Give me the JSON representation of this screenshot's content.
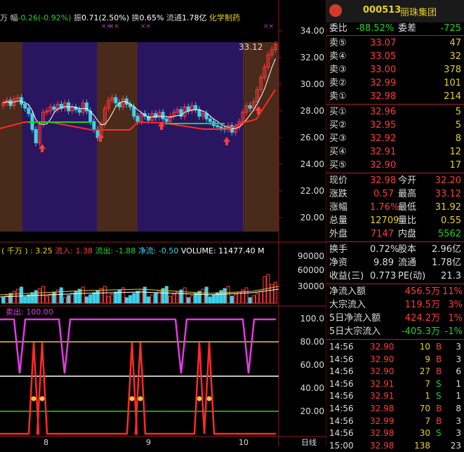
{
  "topbar": {
    "prefix": "万",
    "amp_label": "幅",
    "amp_value": "-0.26(-0.92%)",
    "zhen_label": "振",
    "zhen_value": "0.71(2.50%)",
    "huan_label": "换",
    "huan_value": "0.65%",
    "liutong_label": "流通",
    "liutong_value": "1.78亿",
    "industry": "化学制药"
  },
  "price_axis": [
    "34.00",
    "32.00",
    "30.00",
    "28.00",
    "26.00",
    "24.00",
    "22.00",
    "20.00"
  ],
  "price_marker": "33.12",
  "volume_axis": [
    "90000",
    "60000",
    "30000"
  ],
  "indicator_axis": [
    "100.0",
    "80.00",
    "60.00",
    "40.00",
    "20.00"
  ],
  "date_labels": [
    "8",
    "9",
    "10"
  ],
  "period_label": "日线",
  "fund_flow": {
    "open": "( 千万 ) : 3.25",
    "in_label": "流入:",
    "in_value": "1.38",
    "out_label": "流出:",
    "out_value": "-1.88",
    "net_label": "净流:",
    "net_value": "-0.50",
    "volume_label": "VOLUME:",
    "volume_value": "11477.40",
    "trail": "M"
  },
  "sell_label": "卖出: 100.00",
  "quote": {
    "code": "000513",
    "name": "丽珠集团",
    "weibi_label": "委比",
    "weibi_value": "-88.52%",
    "weicha_label": "委差",
    "weicha_value": "-725",
    "sells": [
      {
        "label": "卖⑤",
        "price": "33.07",
        "vol": "47"
      },
      {
        "label": "卖④",
        "price": "33.05",
        "vol": "32"
      },
      {
        "label": "卖③",
        "price": "33.00",
        "vol": "378"
      },
      {
        "label": "卖②",
        "price": "32.99",
        "vol": "101"
      },
      {
        "label": "卖①",
        "price": "32.98",
        "vol": "214"
      }
    ],
    "buys": [
      {
        "label": "买①",
        "price": "32.96",
        "vol": "5"
      },
      {
        "label": "买②",
        "price": "32.95",
        "vol": "5"
      },
      {
        "label": "买③",
        "price": "32.92",
        "vol": "8"
      },
      {
        "label": "买④",
        "price": "32.91",
        "vol": "12"
      },
      {
        "label": "买⑤",
        "price": "32.90",
        "vol": "17"
      }
    ],
    "stats": [
      {
        "l1": "现价",
        "v1": "32.98",
        "c1": "#ff3b3b",
        "l2": "今开",
        "v2": "32.20",
        "c2": "#ff3b3b"
      },
      {
        "l1": "涨跌",
        "v1": "0.57",
        "c1": "#ff3b3b",
        "l2": "最高",
        "v2": "33.12",
        "c2": "#ff3b3b"
      },
      {
        "l1": "涨幅",
        "v1": "1.76%",
        "c1": "#ff3b3b",
        "l2": "最低",
        "v2": "31.92",
        "c2": "#e6d21c"
      },
      {
        "l1": "总量",
        "v1": "12709",
        "c1": "#e6d21c",
        "l2": "量比",
        "v2": "0.55",
        "c2": "#e6d21c"
      },
      {
        "l1": "外盘",
        "v1": "7147",
        "c1": "#ff3b3b",
        "l2": "内盘",
        "v2": "5562",
        "c2": "#21d321"
      }
    ],
    "stats2": [
      {
        "l1": "换手",
        "v1": "0.72%",
        "c1": "#ddd",
        "l2": "股本",
        "v2": "2.96亿",
        "c2": "#ddd"
      },
      {
        "l1": "净资",
        "v1": "9.89",
        "c1": "#ddd",
        "l2": "流通",
        "v2": "1.78亿",
        "c2": "#ddd"
      },
      {
        "l1": "收益(三)",
        "v1": "0.773",
        "c1": "#ddd",
        "l2": "PE(动)",
        "v2": "21.3",
        "c2": "#ddd"
      }
    ],
    "flows": [
      {
        "label": "净流入额",
        "value": "456.5万",
        "pct": "11%",
        "color": "#ff3b3b"
      },
      {
        "label": "大宗流入",
        "value": "119.5万",
        "pct": "3%",
        "color": "#ff3b3b"
      },
      {
        "label": "5日净流入额",
        "value": "424.2万",
        "pct": "1%",
        "color": "#ff3b3b"
      },
      {
        "label": "5日大宗流入",
        "value": "-405.3万",
        "pct": "-1%",
        "color": "#21d321"
      }
    ],
    "ticks": [
      {
        "time": "14:56",
        "price": "32.90",
        "vol": "10",
        "bs": "B",
        "n": "3",
        "pc": "#ff3b3b",
        "bc": "#ff3b3b"
      },
      {
        "time": "14:56",
        "price": "32.90",
        "vol": "9",
        "bs": "B",
        "n": "3",
        "pc": "#ff3b3b",
        "bc": "#ff3b3b"
      },
      {
        "time": "14:56",
        "price": "32.90",
        "vol": "27",
        "bs": "B",
        "n": "6",
        "pc": "#ff3b3b",
        "bc": "#ff3b3b"
      },
      {
        "time": "14:56",
        "price": "32.91",
        "vol": "7",
        "bs": "S",
        "n": "1",
        "pc": "#ff3b3b",
        "bc": "#21d321"
      },
      {
        "time": "14:56",
        "price": "32.91",
        "vol": "1",
        "bs": "S",
        "n": "1",
        "pc": "#ff3b3b",
        "bc": "#21d321"
      },
      {
        "time": "14:56",
        "price": "32.98",
        "vol": "70",
        "bs": "B",
        "n": "8",
        "pc": "#ff3b3b",
        "bc": "#ff3b3b"
      },
      {
        "time": "14:56",
        "price": "32.99",
        "vol": "7",
        "bs": "B",
        "n": "3",
        "pc": "#ff3b3b",
        "bc": "#ff3b3b"
      },
      {
        "time": "14:56",
        "price": "32.98",
        "vol": "30",
        "bs": "S",
        "n": "3",
        "pc": "#ff3b3b",
        "bc": "#21d321"
      },
      {
        "time": "15:00",
        "price": "32.98",
        "vol": "138",
        "bs": "",
        "n": "23",
        "pc": "#ff3b3b",
        "bc": "#ff3b3b"
      }
    ]
  }
}
